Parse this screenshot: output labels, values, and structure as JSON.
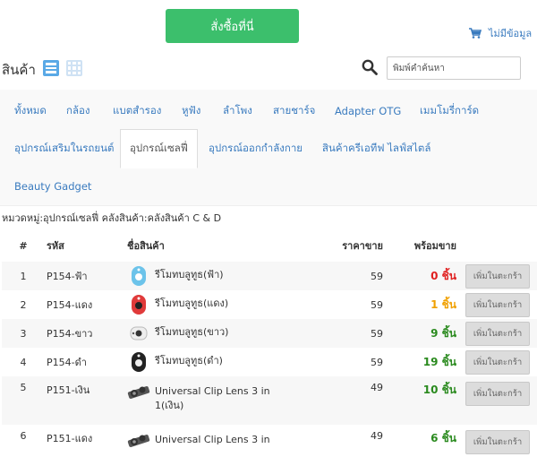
{
  "header": {
    "order_button": "สั่งซื้อที่นี่",
    "cart_label": "ไม่มีข้อมูล"
  },
  "toolbar": {
    "title": "สินค้า",
    "search_placeholder": "พิมพ์คำค้นหา"
  },
  "tabs": [
    {
      "label": "ทั้งหมด",
      "active": false
    },
    {
      "label": "กล้อง",
      "active": false
    },
    {
      "label": "แบตสำรอง",
      "active": false
    },
    {
      "label": "หูฟัง",
      "active": false
    },
    {
      "label": "ลำโพง",
      "active": false
    },
    {
      "label": "สายชาร์จ",
      "active": false
    },
    {
      "label": "Adapter OTG",
      "active": false
    },
    {
      "label": "เมมโมรี่การ์ด",
      "active": false
    },
    {
      "label": "อุปกรณ์เสริมในรถยนต์",
      "active": false
    },
    {
      "label": "อุปกรณ์เซลฟี่",
      "active": true
    },
    {
      "label": "อุปกรณ์ออกกำลังกาย",
      "active": false
    },
    {
      "label": "สินค้าครีเอทีฟ ไลฟ์สไตล์",
      "active": false
    },
    {
      "label": "Beauty Gadget",
      "active": false
    }
  ],
  "category_path": "หมวดหมู่:อุปกรณ์เซลฟี่ คลังสินค้า:คลังสินค้า C & D",
  "table": {
    "headers": {
      "index": "#",
      "code": "รหัส",
      "name": "ชื่อสินค้า",
      "price": "ราคาขาย",
      "stock": "พร้อมขาย"
    },
    "add_label": "เพิ่มในตะกร้า",
    "rows": [
      {
        "index": "1",
        "code": "P154-ฟ้า",
        "name": "รีโมทบลูทูธ(ฟ้า)",
        "price": "59",
        "stock": "0 ชิ้น",
        "stock_status": "red",
        "thumb_icon": "remote-blue-icon",
        "thumb_color": "#6cc3ea"
      },
      {
        "index": "2",
        "code": "P154-แดง",
        "name": "รีโมทบลูทูธ(แดง)",
        "price": "59",
        "stock": "1 ชิ้น",
        "stock_status": "orange",
        "thumb_icon": "remote-red-icon",
        "thumb_color": "#e03a3a"
      },
      {
        "index": "3",
        "code": "P154-ขาว",
        "name": "รีโมทบลูทูธ(ขาว)",
        "price": "59",
        "stock": "9 ชิ้น",
        "stock_status": "green",
        "thumb_icon": "remote-white-icon",
        "thumb_color": "#eeeeee"
      },
      {
        "index": "4",
        "code": "P154-ดำ",
        "name": "รีโมทบลูทูธ(ดำ)",
        "price": "59",
        "stock": "19 ชิ้น",
        "stock_status": "green",
        "thumb_icon": "remote-black-icon",
        "thumb_color": "#222222"
      },
      {
        "index": "5",
        "code": "P151-เงิน",
        "name": "Universal Clip Lens 3 in 1(เงิน)",
        "price": "49",
        "stock": "10 ชิ้น",
        "stock_status": "green",
        "thumb_icon": "clip-lens-icon",
        "thumb_color": "#555555"
      },
      {
        "index": "6",
        "code": "P151-แดง",
        "name": "Universal Clip Lens 3 in",
        "price": "49",
        "stock": "6 ชิ้น",
        "stock_status": "green",
        "thumb_icon": "clip-lens-icon",
        "thumb_color": "#555555"
      }
    ]
  },
  "colors": {
    "accent": "#3cbf6c",
    "link": "#3a7bbf",
    "red": "#e02020",
    "orange": "#f0a000",
    "green": "#2a8a1e"
  }
}
